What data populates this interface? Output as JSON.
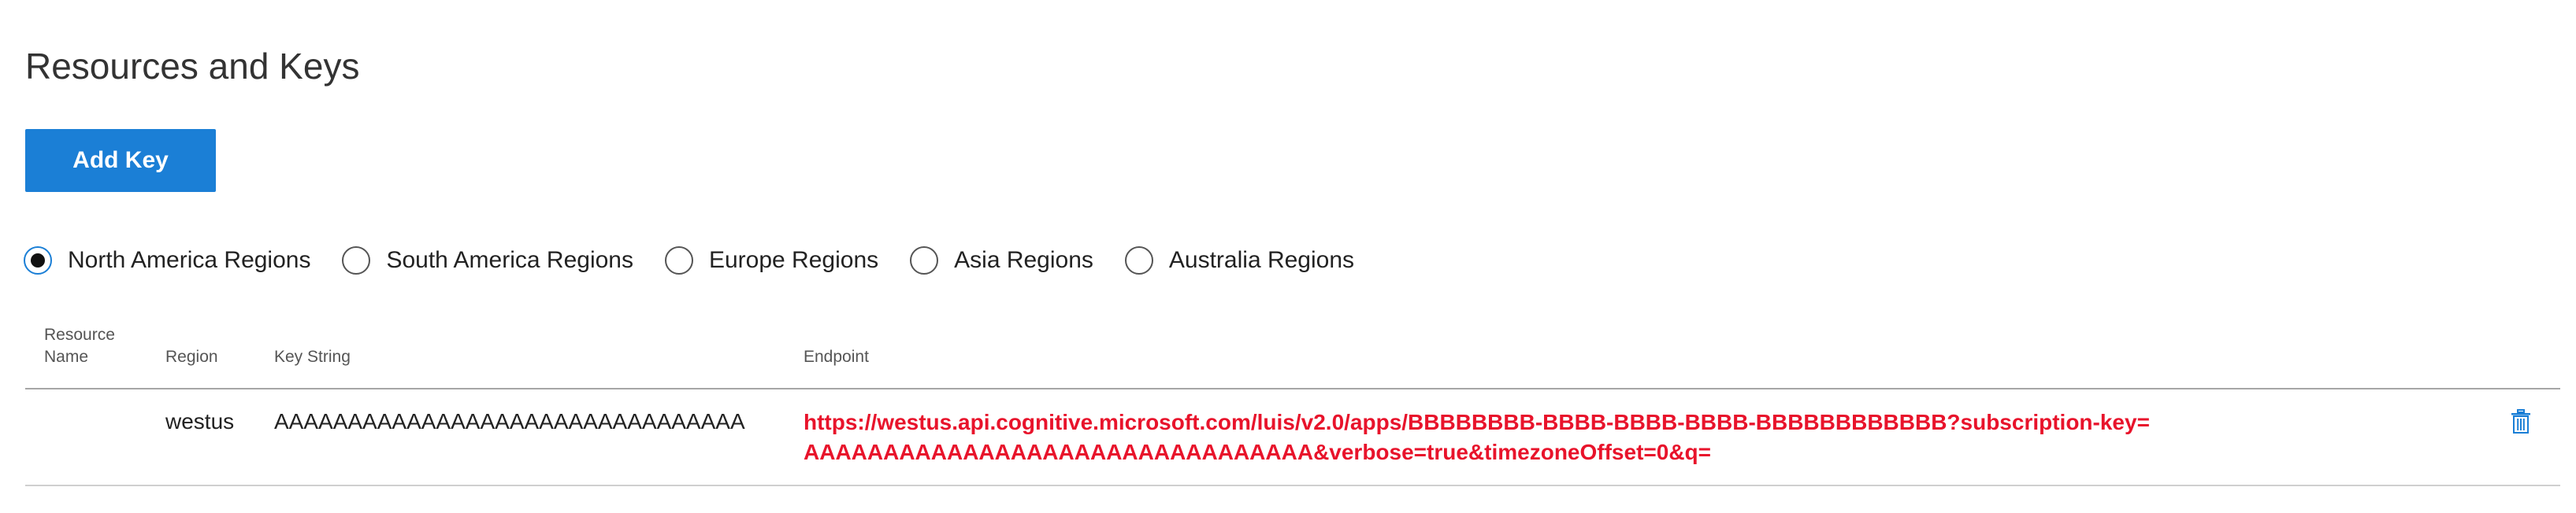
{
  "page": {
    "title": "Resources and Keys"
  },
  "toolbar": {
    "add_key_label": "Add Key"
  },
  "regions": [
    {
      "label": "North America Regions",
      "selected": true
    },
    {
      "label": "South America Regions",
      "selected": false
    },
    {
      "label": "Europe Regions",
      "selected": false
    },
    {
      "label": "Asia Regions",
      "selected": false
    },
    {
      "label": "Australia Regions",
      "selected": false
    }
  ],
  "table": {
    "headers": {
      "resource_name": "Resource Name",
      "region": "Region",
      "key_string": "Key String",
      "endpoint": "Endpoint"
    },
    "rows": [
      {
        "resource_name": "",
        "region": "westus",
        "key_string": "AAAAAAAAAAAAAAAAAAAAAAAAAAAAAAAA",
        "endpoint": "https://westus.api.cognitive.microsoft.com/luis/v2.0/apps/BBBBBBBB-BBBB-BBBB-BBBB-BBBBBBBBBBBB?subscription-key=AAAAAAAAAAAAAAAAAAAAAAAAAAAAAAAA&verbose=true&timezoneOffset=0&q=",
        "delete_icon": "trash-icon"
      }
    ]
  },
  "colors": {
    "accent": "#1b7fd6",
    "endpoint_text": "#e8132b",
    "delete_icon": "#1b7fd6"
  }
}
